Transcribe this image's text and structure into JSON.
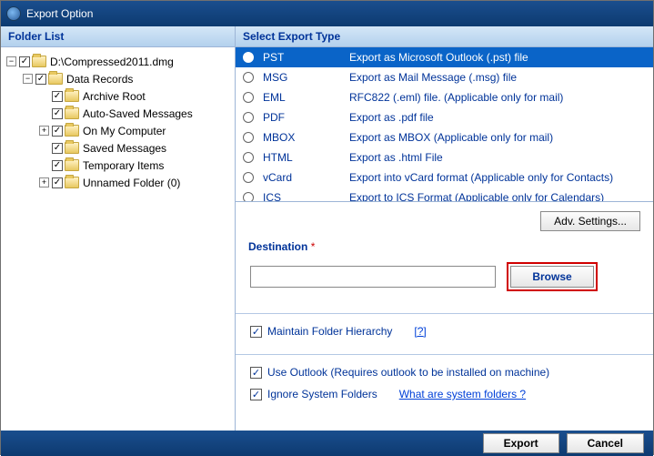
{
  "title": "Export Option",
  "left": {
    "header": "Folder List",
    "tree": [
      {
        "depth": 0,
        "expand": "-",
        "label": "D:\\Compressed2011.dmg"
      },
      {
        "depth": 1,
        "expand": "-",
        "label": "Data Records"
      },
      {
        "depth": 2,
        "expand": "",
        "label": "Archive Root"
      },
      {
        "depth": 2,
        "expand": "",
        "label": "Auto-Saved Messages"
      },
      {
        "depth": 2,
        "expand": "+",
        "label": "On My Computer"
      },
      {
        "depth": 2,
        "expand": "",
        "label": "Saved Messages"
      },
      {
        "depth": 2,
        "expand": "",
        "label": "Temporary Items"
      },
      {
        "depth": 2,
        "expand": "+",
        "label": "Unnamed Folder (0)"
      }
    ]
  },
  "right": {
    "header": "Select Export Type",
    "types": [
      {
        "format": "PST",
        "desc": "Export as Microsoft Outlook (.pst) file",
        "selected": true
      },
      {
        "format": "MSG",
        "desc": "Export as Mail Message (.msg) file"
      },
      {
        "format": "EML",
        "desc": "RFC822 (.eml) file. (Applicable only for mail)"
      },
      {
        "format": "PDF",
        "desc": "Export as .pdf file"
      },
      {
        "format": "MBOX",
        "desc": "Export as MBOX (Applicable only for mail)"
      },
      {
        "format": "HTML",
        "desc": "Export as .html File"
      },
      {
        "format": "vCard",
        "desc": "Export into vCard format (Applicable only for Contacts)"
      },
      {
        "format": "ICS",
        "desc": "Export to ICS Format (Applicable only for Calendars)"
      }
    ],
    "adv_settings": "Adv. Settings...",
    "destination_label": "Destination",
    "destination_value": "",
    "browse_label": "Browse",
    "maintain_hierarchy": "Maintain Folder Hierarchy",
    "maintain_help": "[?]",
    "use_outlook": "Use Outlook (Requires outlook to be installed on machine)",
    "ignore_sys": "Ignore System Folders",
    "ignore_help": "What are system folders ?"
  },
  "footer": {
    "export": "Export",
    "cancel": "Cancel"
  }
}
